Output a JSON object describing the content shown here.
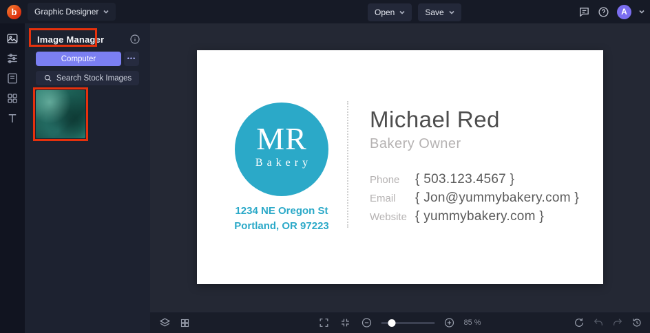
{
  "topbar": {
    "logo": "b",
    "app_menu_label": "Graphic Designer",
    "open_label": "Open",
    "save_label": "Save",
    "avatar_initial": "A"
  },
  "rail": {
    "items": [
      "image-manager",
      "edit-settings",
      "templates",
      "graphics",
      "text"
    ]
  },
  "panel": {
    "title": "Image Manager",
    "computer_label": "Computer",
    "more_label": "•••",
    "search_label": "Search Stock Images"
  },
  "card": {
    "logo_initials": "MR",
    "logo_word": "Bakery",
    "address_line1": "1234 NE Oregon St",
    "address_line2": "Portland, OR 97223",
    "person_name": "Michael Red",
    "person_title": "Bakery Owner",
    "contacts": [
      {
        "label": "Phone",
        "value": "{ 503.123.4567 }"
      },
      {
        "label": "Email",
        "value": "{ Jon@yummybakery.com }"
      },
      {
        "label": "Website",
        "value": "{ yummybakery.com }"
      }
    ]
  },
  "bottombar": {
    "zoom_level": "85 %"
  },
  "icons": {
    "topbar": [
      "feedback-icon",
      "help-icon",
      "account-chevron-icon"
    ],
    "bottombar": [
      "layers-icon",
      "grid-icon",
      "fullscreen-icon",
      "fit-screen-icon",
      "zoom-out-icon",
      "zoom-in-icon",
      "sync-icon",
      "undo-icon",
      "redo-icon",
      "history-icon"
    ]
  },
  "colors": {
    "accent_purple": "#7b7ff2",
    "brand_teal": "#2ba9c8",
    "annotation_red": "#e6310c",
    "logo_orange": "#e8470f"
  }
}
